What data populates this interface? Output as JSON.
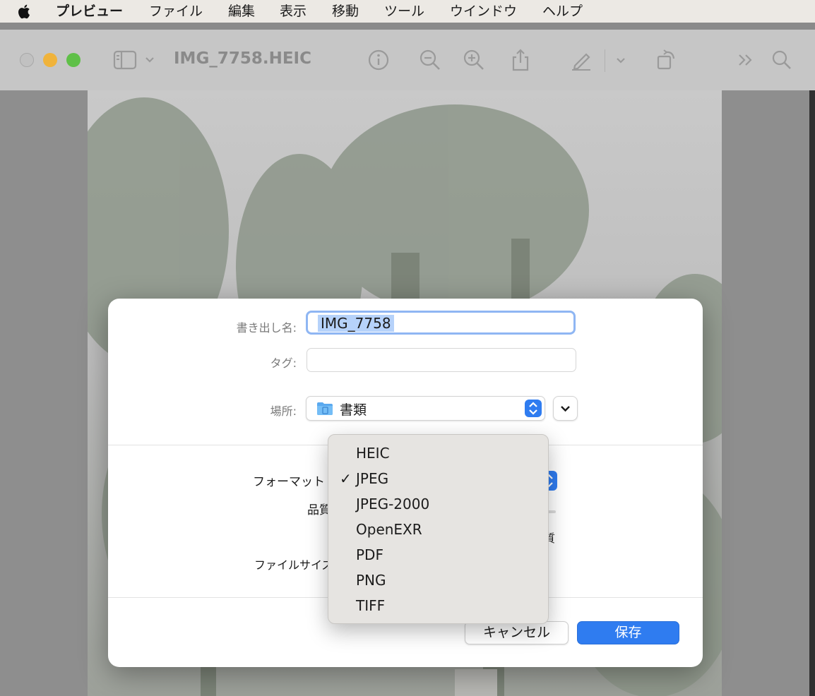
{
  "menubar": {
    "app_name": "プレビュー",
    "items": [
      "ファイル",
      "編集",
      "表示",
      "移動",
      "ツール",
      "ウインドウ",
      "ヘルプ"
    ]
  },
  "window": {
    "title": "IMG_7758.HEIC"
  },
  "dialog": {
    "export_name_label": "書き出し名:",
    "export_name_value": "IMG_7758",
    "tags_label": "タグ:",
    "tags_value": "",
    "location_label": "場所:",
    "location_value": "書類",
    "format_label": "フォーマット",
    "quality_label": "品質",
    "quality_suffix": "質",
    "file_size_label": "ファイルサイズ",
    "cancel_label": "キャンセル",
    "save_label": "保存"
  },
  "format_menu": {
    "selected": "JPEG",
    "check_mark": "✓",
    "options": [
      "HEIC",
      "JPEG",
      "JPEG-2000",
      "OpenEXR",
      "PDF",
      "PNG",
      "TIFF"
    ]
  },
  "colors": {
    "accent": "#2f7cf0",
    "selection": "#b6d2fa",
    "focus_ring": "#8fb6f3",
    "traffic_close": "#c1c1c1",
    "traffic_min": "#f0b33b",
    "traffic_max": "#5fc048"
  },
  "icons": {
    "apple": "apple-logo-icon",
    "sidebar": "sidebar-toggle-icon",
    "info": "info-icon",
    "zoom_out": "zoom-out-icon",
    "zoom_in": "zoom-in-icon",
    "share": "share-icon",
    "markup": "markup-pen-icon",
    "rotate": "rotate-icon",
    "more": "more-chevrons-icon",
    "search": "search-icon",
    "folder": "documents-folder-icon"
  }
}
